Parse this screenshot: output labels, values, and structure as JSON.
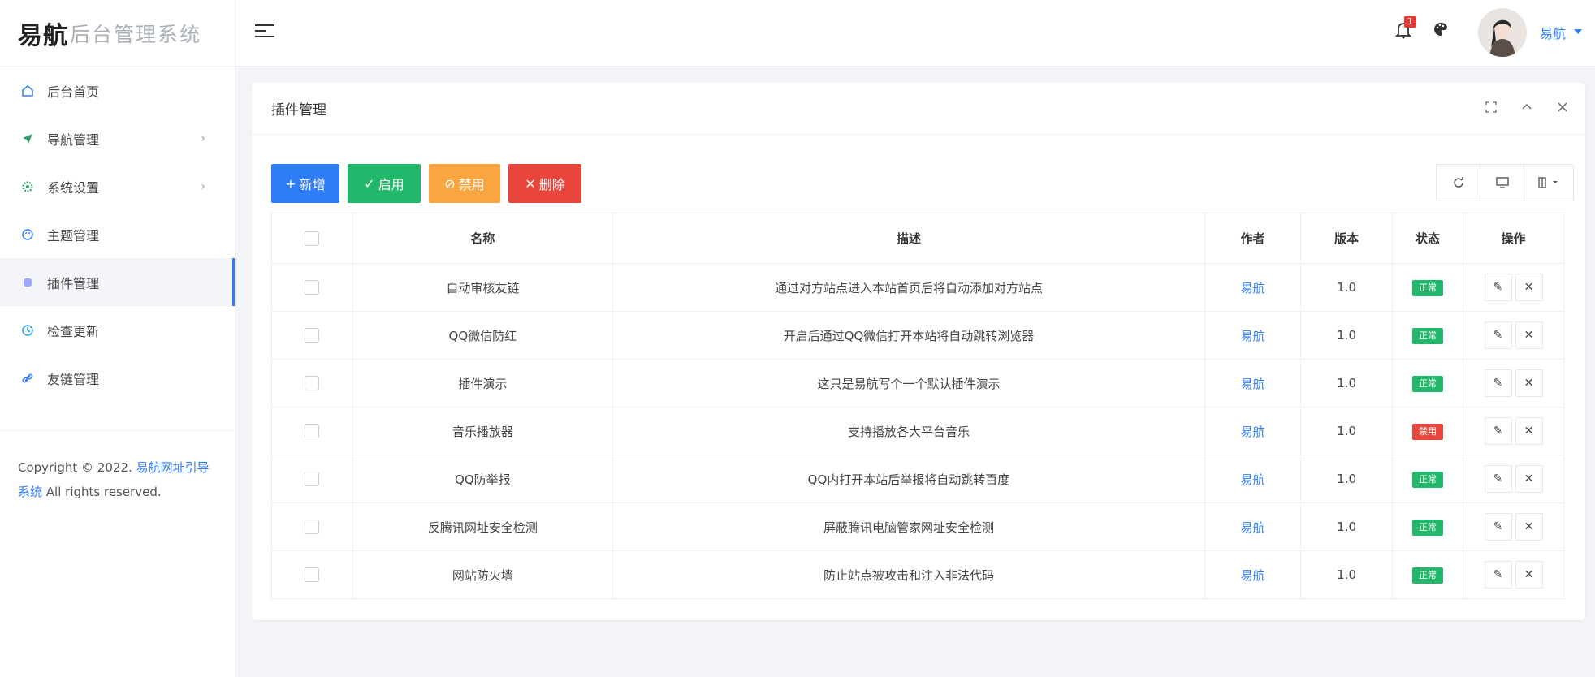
{
  "brand": {
    "main": "易航",
    "sub": "后台管理系统"
  },
  "sidebar": {
    "items": [
      {
        "label": "后台首页",
        "icon": "home-icon",
        "has_arrow": false,
        "active": false
      },
      {
        "label": "导航管理",
        "icon": "send-icon",
        "has_arrow": true,
        "active": false
      },
      {
        "label": "系统设置",
        "icon": "gear-icon",
        "has_arrow": true,
        "active": false
      },
      {
        "label": "主题管理",
        "icon": "palette-icon",
        "has_arrow": false,
        "active": false
      },
      {
        "label": "插件管理",
        "icon": "plugin-icon",
        "has_arrow": false,
        "active": true
      },
      {
        "label": "检查更新",
        "icon": "refresh-icon",
        "has_arrow": false,
        "active": false
      },
      {
        "label": "友链管理",
        "icon": "link-icon",
        "has_arrow": false,
        "active": false
      }
    ],
    "copyright_prefix": "Copyright © 2022.",
    "copyright_link": "易航网址引导系统",
    "copyright_suffix": "All rights reserved."
  },
  "header": {
    "notification_count": "1",
    "user_name": "易航"
  },
  "panel": {
    "title": "插件管理",
    "buttons": {
      "add": "新增",
      "enable": "启用",
      "disable": "禁用",
      "delete": "删除"
    }
  },
  "table": {
    "headers": [
      "名称",
      "描述",
      "作者",
      "版本",
      "状态",
      "操作"
    ],
    "rows": [
      {
        "name": "自动审核友链",
        "desc": "通过对方站点进入本站首页后将自动添加对方站点",
        "author": "易航",
        "version": "1.0",
        "status": "正常",
        "status_type": "ok"
      },
      {
        "name": "QQ微信防红",
        "desc": "开启后通过QQ微信打开本站将自动跳转浏览器",
        "author": "易航",
        "version": "1.0",
        "status": "正常",
        "status_type": "ok"
      },
      {
        "name": "插件演示",
        "desc": "这只是易航写个一个默认插件演示",
        "author": "易航",
        "version": "1.0",
        "status": "正常",
        "status_type": "ok"
      },
      {
        "name": "音乐播放器",
        "desc": "支持播放各大平台音乐",
        "author": "易航",
        "version": "1.0",
        "status": "禁用",
        "status_type": "off"
      },
      {
        "name": "QQ防举报",
        "desc": "QQ内打开本站后举报将自动跳转百度",
        "author": "易航",
        "version": "1.0",
        "status": "正常",
        "status_type": "ok"
      },
      {
        "name": "反腾讯网址安全检测",
        "desc": "屏蔽腾讯电脑管家网址安全检测",
        "author": "易航",
        "version": "1.0",
        "status": "正常",
        "status_type": "ok"
      },
      {
        "name": "网站防火墙",
        "desc": "防止站点被攻击和注入非法代码",
        "author": "易航",
        "version": "1.0",
        "status": "正常",
        "status_type": "ok"
      }
    ]
  },
  "colors": {
    "primary": "#2f7df6",
    "success": "#22b76b",
    "warning": "#f9a641",
    "danger": "#e8463d"
  }
}
